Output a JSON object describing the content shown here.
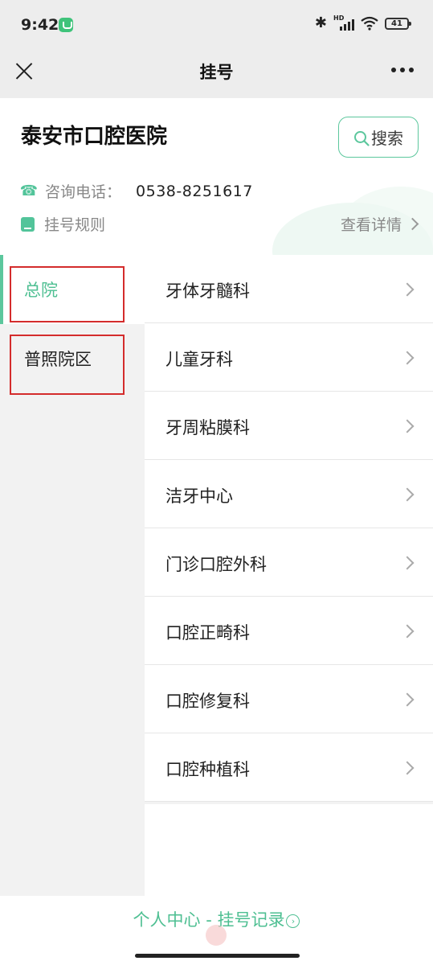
{
  "status_bar": {
    "time": "9:42",
    "hd_label": "HD",
    "battery": "41",
    "icons": [
      "app-badge-icon",
      "bluetooth-icon",
      "signal-icon",
      "wifi-icon",
      "battery-icon"
    ]
  },
  "nav": {
    "title": "挂号",
    "close_icon": "close-icon",
    "more_icon": "more-icon"
  },
  "hospital": {
    "name": "泰安市口腔医院",
    "search_label": "搜索",
    "phone_label": "咨询电话：",
    "phone_number": "0538-8251617",
    "rules_label": "挂号规则",
    "detail_label": "查看详情"
  },
  "campuses": [
    {
      "label": "总院",
      "active": true
    },
    {
      "label": "普照院区",
      "active": false
    }
  ],
  "departments": [
    {
      "label": "牙体牙髓科"
    },
    {
      "label": "儿童牙科"
    },
    {
      "label": "牙周粘膜科"
    },
    {
      "label": "洁牙中心"
    },
    {
      "label": "门诊口腔外科"
    },
    {
      "label": "口腔正畸科"
    },
    {
      "label": "口腔修复科"
    },
    {
      "label": "口腔种植科"
    }
  ],
  "footer": {
    "link_label": "个人中心 - 挂号记录"
  },
  "colors": {
    "accent": "#4ebf92",
    "highlight": "#d42c2c"
  }
}
